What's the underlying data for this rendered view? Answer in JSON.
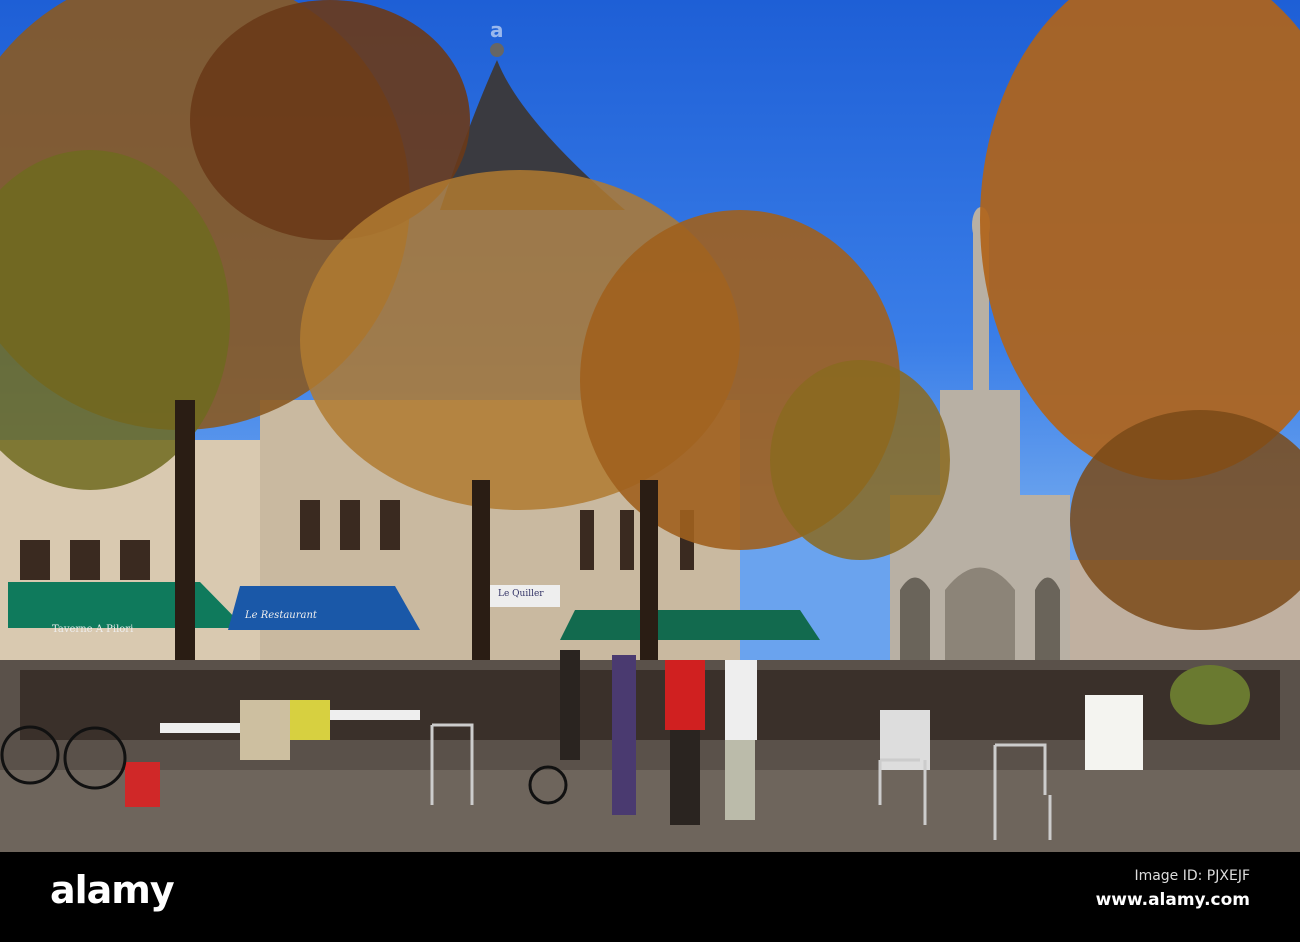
{
  "photo": {
    "signs": {
      "taverne": "Taverne A Pilori",
      "restaurant": "Le Restaurant",
      "quiller": "Le Quiller"
    },
    "watermark": "a"
  },
  "footer": {
    "logo": "alamy",
    "image_id": "Image ID: PJXEJF",
    "url": "www.alamy.com"
  }
}
